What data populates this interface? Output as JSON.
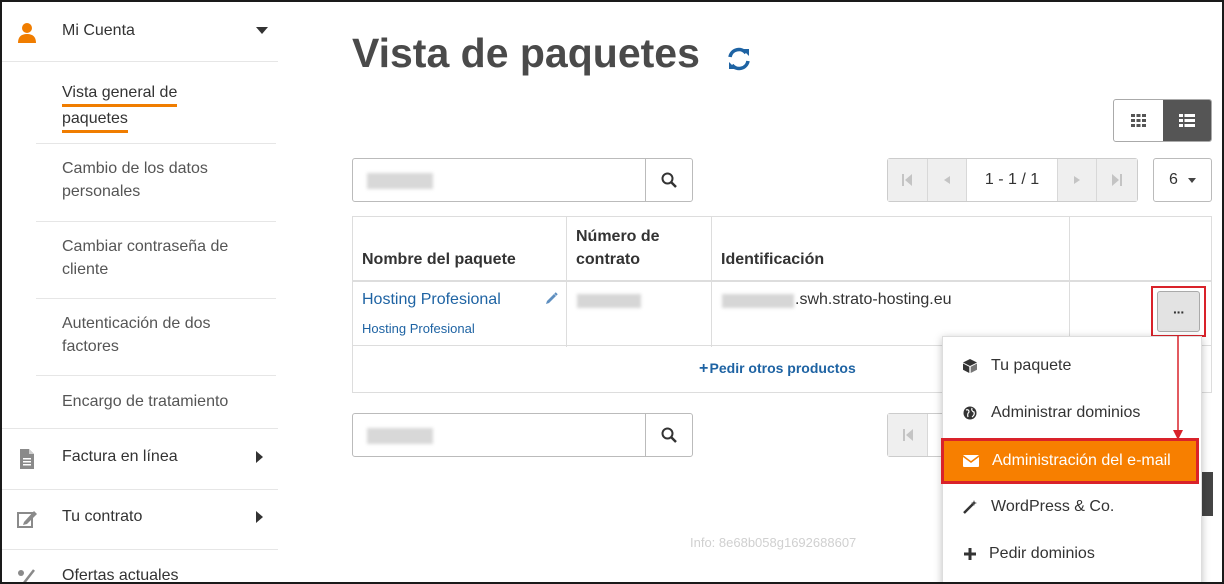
{
  "sidebar": {
    "account": {
      "label": "Mi Cuenta"
    },
    "subitems": [
      {
        "label": "Vista general de paquetes",
        "line1": "Vista general de",
        "line2": "paquetes"
      },
      {
        "line1": "Cambio de los datos",
        "line2": "personales"
      },
      {
        "line1": "Cambiar contraseña de",
        "line2": "cliente"
      },
      {
        "line1": "Autenticación de dos",
        "line2": "factores"
      },
      {
        "line1": "Encargo de tratamiento"
      }
    ],
    "invoice": {
      "label": "Factura en línea"
    },
    "contract": {
      "label": "Tu contrato"
    },
    "offers": {
      "label": "Ofertas actuales"
    }
  },
  "main": {
    "title": "Vista de paquetes",
    "pagination": {
      "label": "1 - 1 / 1",
      "per_page": "6"
    },
    "table": {
      "headers": {
        "name": "Nombre del paquete",
        "contract_line1": "Número de",
        "contract_line2": "contrato",
        "identification": "Identificación"
      },
      "row": {
        "package_name": "Hosting Profesional",
        "package_sub": "Hosting Profesional",
        "identification_suffix": ".swh.strato-hosting.eu"
      },
      "more_products": "Pedir otros productos"
    },
    "actions_button": "···",
    "dropdown": [
      {
        "label": "Tu paquete",
        "icon": "cube-icon"
      },
      {
        "label": "Administrar dominios",
        "icon": "globe-icon"
      },
      {
        "label": "Administración del e-mail",
        "icon": "envelope-icon"
      },
      {
        "label": "WordPress & Co.",
        "icon": "magic-wand-icon"
      },
      {
        "label": "Pedir dominios",
        "icon": "plus-icon"
      }
    ],
    "info": "Info: 8e68b058g1692688607"
  },
  "colors": {
    "accent": "#f77f00",
    "highlight_border": "#d9222a",
    "link": "#1e63a3"
  }
}
